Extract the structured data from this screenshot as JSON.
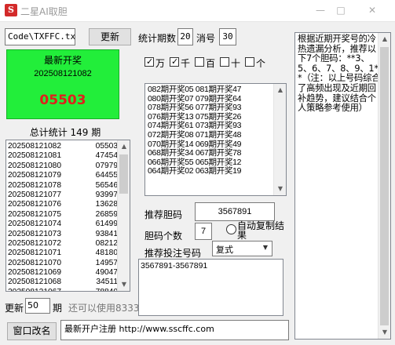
{
  "window": {
    "title": "二星AI取胆",
    "app_icon_glyph": "S",
    "min_glyph": "—",
    "max_glyph": "□",
    "close_glyph": "✕"
  },
  "toolbar": {
    "file_value": "Code\\TXFFC.txt",
    "refresh_label": "更新",
    "stat_periods_label": "统计期数",
    "stat_periods_value": "20",
    "count_label": "消号",
    "count_value": "30"
  },
  "latest": {
    "title": "最新开奖",
    "period": "202508121082",
    "number": "05503",
    "bg_color": "#22ee3a",
    "number_color": "#e0201c"
  },
  "summary": {
    "total_label": "总计统计 149 期"
  },
  "history": [
    {
      "period": "202508121082",
      "number": "05503"
    },
    {
      "period": "202508121081",
      "number": "47454"
    },
    {
      "period": "202508121080",
      "number": "07979"
    },
    {
      "period": "202508121079",
      "number": "64455"
    },
    {
      "period": "202508121078",
      "number": "56546"
    },
    {
      "period": "202508121077",
      "number": "93997"
    },
    {
      "period": "202508121076",
      "number": "13628"
    },
    {
      "period": "202508121075",
      "number": "26859"
    },
    {
      "period": "202508121074",
      "number": "61499"
    },
    {
      "period": "202508121073",
      "number": "93841"
    },
    {
      "period": "202508121072",
      "number": "08212"
    },
    {
      "period": "202508121071",
      "number": "48180"
    },
    {
      "period": "202508121070",
      "number": "14957"
    },
    {
      "period": "202508121069",
      "number": "49047"
    },
    {
      "period": "202508121068",
      "number": "34511"
    },
    {
      "period": "202508121067",
      "number": "78840"
    }
  ],
  "update": {
    "label": "更新",
    "value": "50",
    "unit": "期",
    "usage_text": "还可以使用8333小"
  },
  "digits": [
    {
      "label": "万",
      "checked": true
    },
    {
      "label": "千",
      "checked": true
    },
    {
      "label": "百",
      "checked": false
    },
    {
      "label": "十",
      "checked": false
    },
    {
      "label": "个",
      "checked": false
    }
  ],
  "patterns": [
    "082期开奖05 081期开奖47",
    "080期开奖07 079期开奖64",
    "078期开奖56 077期开奖93",
    "076期开奖13 075期开奖26",
    "074期开奖61 073期开奖93",
    "072期开奖08 071期开奖48",
    "070期开奖14 069期开奖49",
    "068期开奖34 067期开奖78",
    "066期开奖55 065期开奖12",
    "064期开奖02 063期开奖19"
  ],
  "recommend": {
    "label": "推荐胆码",
    "value": "3567891",
    "count_label": "胆码个数",
    "count_value": "7",
    "auto_copy_label": "自动复制结果",
    "bet_label": "推荐投注号码",
    "bet_type": "复式",
    "result": "3567891-3567891"
  },
  "analysis": {
    "text": "根据近期开奖号的冷热遗漏分析，推荐以下7个胆码：**3、5、6、7、8、9、1**（注：以上号码综合了高频出现及近期回补趋势，建议结合个人策略参考使用）"
  },
  "footer": {
    "rename_label": "窗口改名",
    "register_label": "最新开户注册",
    "register_url": "http://www.sscffc.com"
  }
}
